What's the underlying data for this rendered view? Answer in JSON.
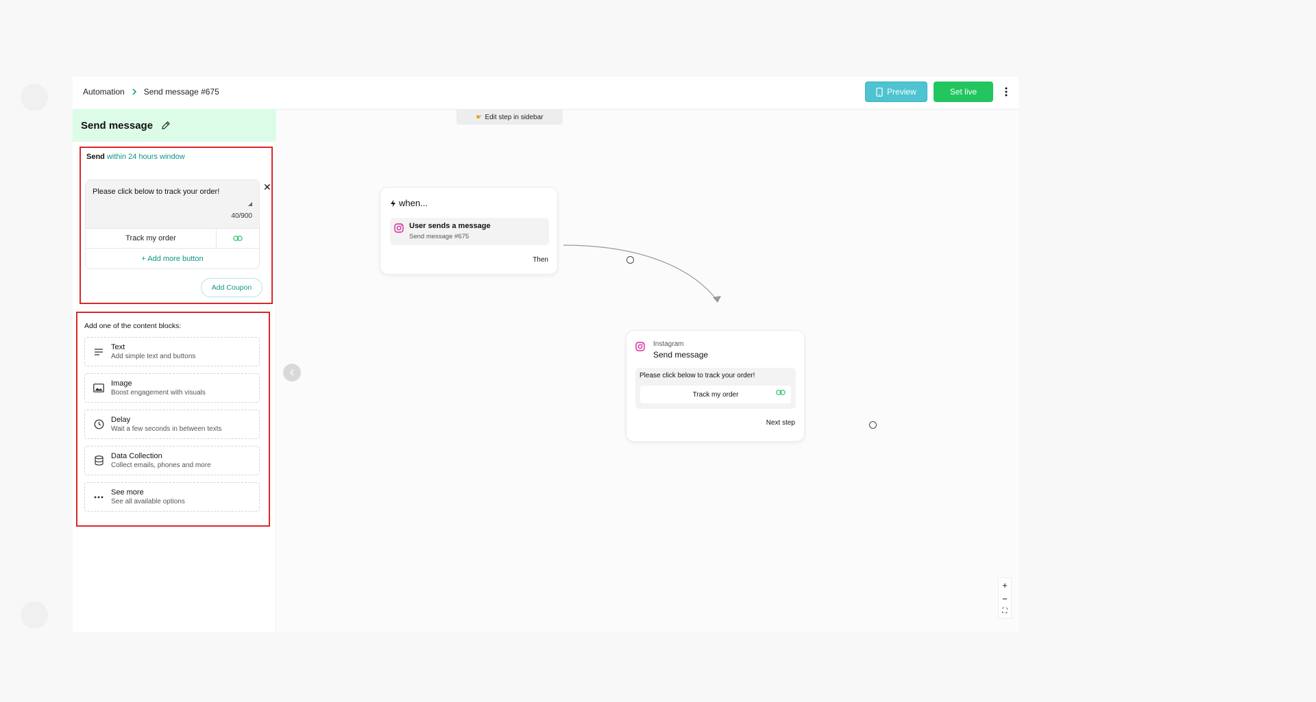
{
  "breadcrumb": {
    "root": "Automation",
    "current": "Send message #675"
  },
  "toolbar": {
    "preview_label": "Preview",
    "set_live_label": "Set live"
  },
  "sidebar": {
    "title": "Send message",
    "send_prefix": "Send",
    "send_window": "within 24 hours window",
    "message_text": "Please click below to track your order!",
    "char_count": "40/900",
    "button_label": "Track my order",
    "add_button_label": "+ Add more button",
    "add_coupon_label": "Add Coupon",
    "blocks_title": "Add one of the content blocks:",
    "blocks": [
      {
        "title": "Text",
        "subtitle": "Add simple text and buttons",
        "icon": "text-lines-icon"
      },
      {
        "title": "Image",
        "subtitle": "Boost engagement with visuals",
        "icon": "image-icon"
      },
      {
        "title": "Delay",
        "subtitle": "Wait a few seconds in between texts",
        "icon": "clock-icon"
      },
      {
        "title": "Data Collection",
        "subtitle": "Collect emails, phones and more",
        "icon": "database-icon"
      },
      {
        "title": "See more",
        "subtitle": "See all available options",
        "icon": "ellipsis-icon"
      }
    ]
  },
  "canvas": {
    "edit_hint": "Edit step in sidebar",
    "trigger": {
      "head": "when...",
      "title": "User sends a message",
      "subtitle": "Send message #675",
      "port_label": "Then"
    },
    "action": {
      "platform": "Instagram",
      "title": "Send message",
      "message_text": "Please click below to track your order!",
      "button_label": "Track my order",
      "port_label": "Next step"
    },
    "zoom": {
      "in": "+",
      "out": "−",
      "fit": "⛶"
    }
  },
  "colors": {
    "accent_teal": "#0d9488",
    "preview_bg": "#4fc3d1",
    "live_bg": "#22c55e",
    "sidebar_head_bg": "#dcfce7",
    "highlight_border": "#dc2626"
  }
}
